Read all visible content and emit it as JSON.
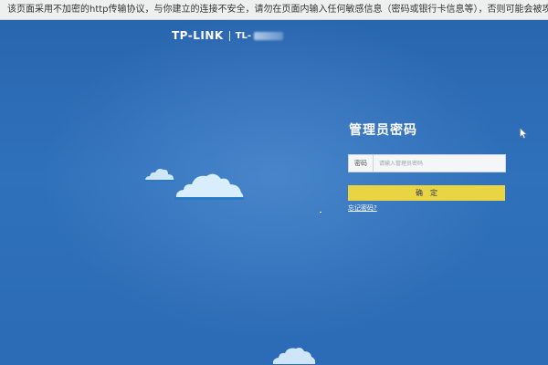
{
  "warning_bar": {
    "text": "该页面采用不加密的http传输协议，与你建立的连接不安全，请勿在页面内输入任何敏感信息（密码或银行卡信息等），否则可能会被攻击者"
  },
  "logo": {
    "brand": "TP-LINK",
    "model_prefix": "TL-"
  },
  "login": {
    "title": "管理员密码",
    "password_label": "密码",
    "password_placeholder": "请输入管理员密码",
    "password_value": "",
    "confirm_label": "确定",
    "forgot_label": "忘记密码?"
  },
  "icons": {
    "cloud": "cloud-icon",
    "cursor": "mouse-cursor-icon"
  },
  "colors": {
    "background": "#2e6db5",
    "button": "#e9d443",
    "cloud": "#d8ecfb"
  }
}
